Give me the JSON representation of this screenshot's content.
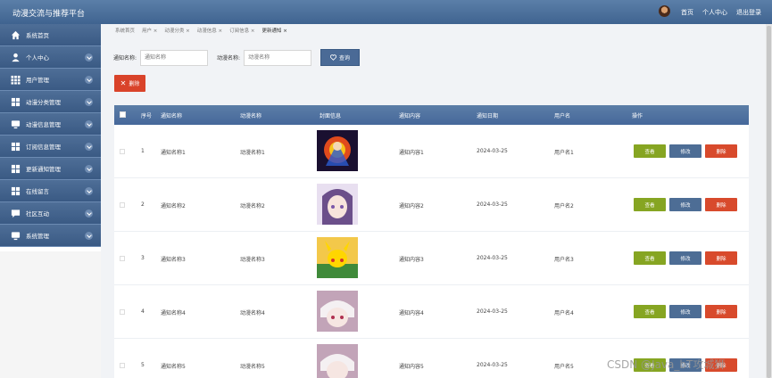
{
  "app": {
    "title": "动漫交流与推荐平台"
  },
  "header": {
    "links": [
      "首页",
      "个人中心",
      "退出登录"
    ]
  },
  "sidebar": {
    "items": [
      {
        "label": "系统首页",
        "icon": "home-icon",
        "chevron": false
      },
      {
        "label": "个人中心",
        "icon": "user-icon",
        "chevron": true
      },
      {
        "label": "用户管理",
        "icon": "grid-icon",
        "chevron": true
      },
      {
        "label": "动漫分类管理",
        "icon": "grid-icon",
        "chevron": true
      },
      {
        "label": "动漫信息管理",
        "icon": "monitor-icon",
        "chevron": true
      },
      {
        "label": "订阅信息管理",
        "icon": "grid-icon",
        "chevron": true
      },
      {
        "label": "更新通知管理",
        "icon": "grid-icon",
        "chevron": true
      },
      {
        "label": "在线留言",
        "icon": "grid-icon",
        "chevron": true
      },
      {
        "label": "社区互动",
        "icon": "chat-icon",
        "chevron": true
      },
      {
        "label": "系统管理",
        "icon": "monitor-icon",
        "chevron": true
      }
    ]
  },
  "breadcrumbs": [
    "系统首页",
    "用户 ×",
    "动漫分类 ×",
    "动漫信息 ×",
    "订阅信息 ×",
    "更新通知 ×"
  ],
  "search": {
    "field1_label": "通知名称:",
    "field1_placeholder": "通知名称",
    "field2_label": "动漫名称:",
    "field2_placeholder": "动漫名称",
    "query_label": "查询"
  },
  "toolbar": {
    "delete_label": "删除"
  },
  "table": {
    "headers": [
      "序号",
      "通知名称",
      "动漫名称",
      "封面信息",
      "通知内容",
      "通知日期",
      "用户名",
      "操作"
    ],
    "rows": [
      {
        "no": "1",
        "notice": "通知名称1",
        "anime": "动漫名称1",
        "content": "通知内容1",
        "date": "2024-03-25",
        "user": "用户名1",
        "cover": "cover-1"
      },
      {
        "no": "2",
        "notice": "通知名称2",
        "anime": "动漫名称2",
        "content": "通知内容2",
        "date": "2024-03-25",
        "user": "用户名2",
        "cover": "cover-2"
      },
      {
        "no": "3",
        "notice": "通知名称3",
        "anime": "动漫名称3",
        "content": "通知内容3",
        "date": "2024-03-25",
        "user": "用户名3",
        "cover": "cover-3"
      },
      {
        "no": "4",
        "notice": "通知名称4",
        "anime": "动漫名称4",
        "content": "通知内容4",
        "date": "2024-03-25",
        "user": "用户名4",
        "cover": "cover-4"
      },
      {
        "no": "5",
        "notice": "通知名称5",
        "anime": "动漫名称5",
        "content": "通知内容5",
        "date": "2024-03-25",
        "user": "用户名5",
        "cover": "cover-5"
      }
    ],
    "actions": {
      "view": "查看",
      "edit": "修改",
      "delete": "删除"
    }
  },
  "watermark": "CSDN @Java_bT攻城狮",
  "colors": {
    "header": "#46689a",
    "view": "#86a522",
    "edit": "#4d6d95",
    "delete": "#d84a2c"
  }
}
